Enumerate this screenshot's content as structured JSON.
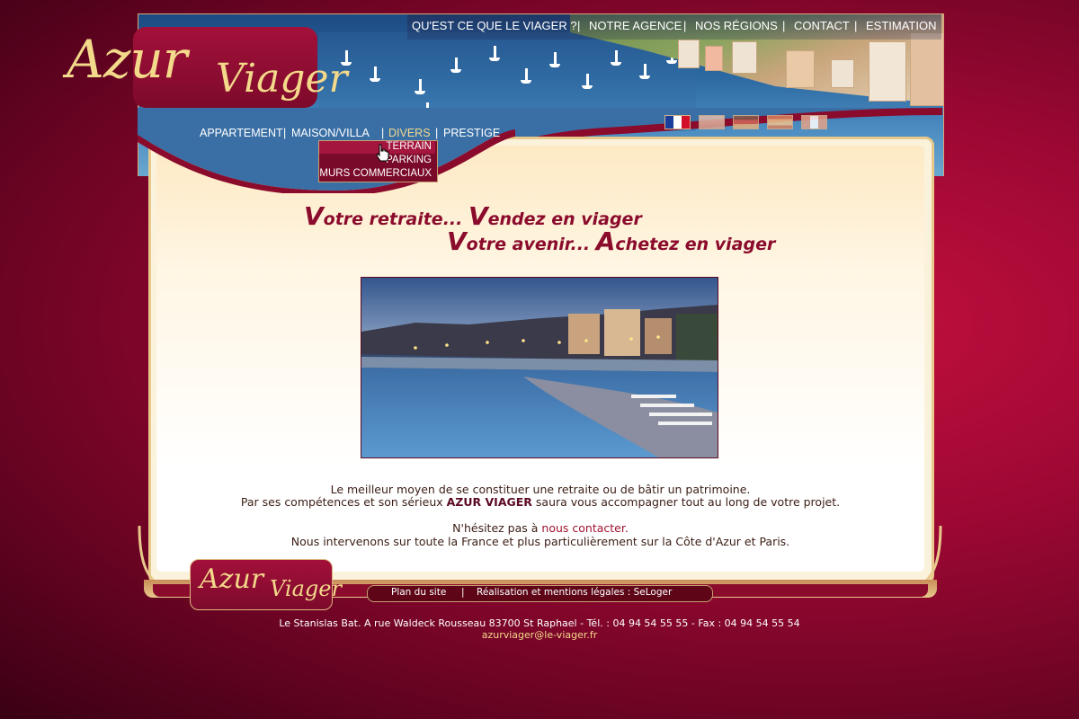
{
  "top_nav": {
    "items": [
      "QU'EST CE QUE LE VIAGER ?",
      "NOTRE AGENCE",
      "NOS RÉGIONS",
      "CONTACT",
      "ESTIMATION"
    ],
    "separator": "|"
  },
  "logo": {
    "part1": "Azur",
    "part2": "Viager"
  },
  "sub_nav": {
    "items": [
      "APPARTEMENT",
      "MAISON/VILLA",
      "DIVERS",
      "PRESTIGE"
    ],
    "separator": "|",
    "active": "DIVERS"
  },
  "dropdown": {
    "items": [
      "TERRAIN",
      "PARKING",
      "MURS COMMERCIAUX"
    ],
    "hovered": "TERRAIN"
  },
  "languages": [
    "french-flag",
    "english-flag",
    "german-flag",
    "spanish-flag",
    "italian-flag"
  ],
  "tagline": {
    "line1_initial": "V",
    "line1_text": "otre retraite... ",
    "line1_initial2": "V",
    "line1_text2": "endez en viager",
    "line2_initial": "V",
    "line2_text": "otre avenir... ",
    "line2_initial2": "A",
    "line2_text2": "chetez en viager"
  },
  "intro": {
    "line1": "Le meilleur moyen de se constituer une retraite ou de bâtir un patrimoine.",
    "line2_pre": "Par ses compétences et son sérieux ",
    "line2_bold": "AZUR VIAGER",
    "line2_post": " saura vous accompagner tout au long de votre projet.",
    "line3_pre": "N'hésitez pas à ",
    "line3_link": "nous contacter.",
    "line4": "Nous intervenons sur toute la France et plus particulièrement sur la Côte d'Azur et Paris."
  },
  "footer": {
    "links": [
      "Plan du site",
      "Réalisation et mentions légales : SeLoger"
    ],
    "separator": "|",
    "address": "Le Stanislas Bat. A rue Waldeck Rousseau 83700 St Raphael - Tél. : 04 94 54 55 55 - Fax : 04 94 54 55 54",
    "email": "azurviager@le-viager.fr"
  },
  "colors": {
    "brand_red": "#8a0b2c",
    "gold": "#f3d98a",
    "link_red": "#a0142f"
  }
}
